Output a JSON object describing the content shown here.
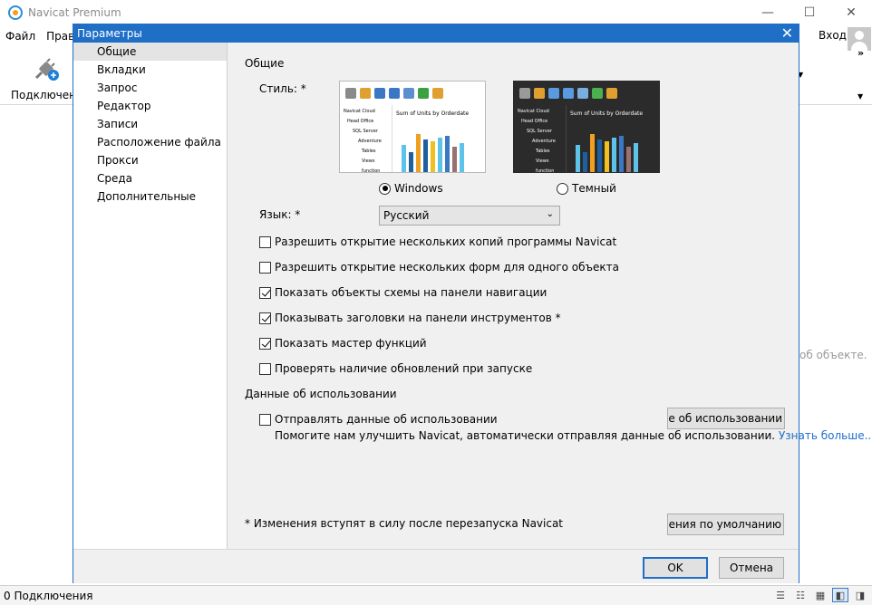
{
  "app": {
    "title": "Navicat Premium"
  },
  "menu": {
    "items": [
      "Файл",
      "Правка"
    ]
  },
  "toolbar": {
    "connection_label": "Подключения",
    "login_label": "Вход",
    "more": "»"
  },
  "background_hint": "об объекте.",
  "status": {
    "connections": "0 Подключения"
  },
  "dialog": {
    "title": "Параметры",
    "nav": [
      "Общие",
      "Вкладки",
      "Запрос",
      "Редактор",
      "Записи",
      "Расположение файла",
      "Прокси",
      "Среда",
      "Дополнительные"
    ],
    "selected_nav": "Общие",
    "general": {
      "section_title": "Общие",
      "style_label": "Стиль: *",
      "preview": {
        "tree": [
          "Navicat Cloud",
          "Head Office",
          "SQL Server",
          "Adventure",
          "Tables",
          "Views",
          "function"
        ],
        "chart_title": "Sum of Units by Orderdate"
      },
      "styles": [
        {
          "label": "Windows",
          "selected": true
        },
        {
          "label": "Темный",
          "selected": false
        }
      ],
      "language_label": "Язык: *",
      "language_value": "Русский",
      "options": [
        {
          "label": "Разрешить открытие нескольких копий программы Navicat",
          "checked": false
        },
        {
          "label": "Разрешить открытие нескольких форм для одного объекта",
          "checked": false
        },
        {
          "label": "Показать объекты схемы на панели навигации",
          "checked": true
        },
        {
          "label": "Показывать заголовки на панели инструментов *",
          "checked": true
        },
        {
          "label": "Показать мастер функций",
          "checked": true
        },
        {
          "label": "Проверять наличие обновлений при запуске",
          "checked": false
        }
      ]
    },
    "usage": {
      "section_title": "Данные об использовании",
      "send_label": "Отправлять данные об использовании",
      "send_checked": false,
      "view_button": "Просмотреть данные об использовании",
      "help_text": "Помогите нам улучшить Navicat, автоматически отправляя данные об использовании.",
      "learn_more": "Узнать больше..."
    },
    "restart_note": "* Изменения вступят в силу после перезапуска Navicat",
    "defaults_button": "Восстановить значения по умолчанию",
    "ok": "OK",
    "cancel": "Отмена"
  },
  "colors": {
    "accent": "#1f6fc7",
    "selected_nav": "#e4e4e4",
    "link": "#1f6fc7"
  }
}
